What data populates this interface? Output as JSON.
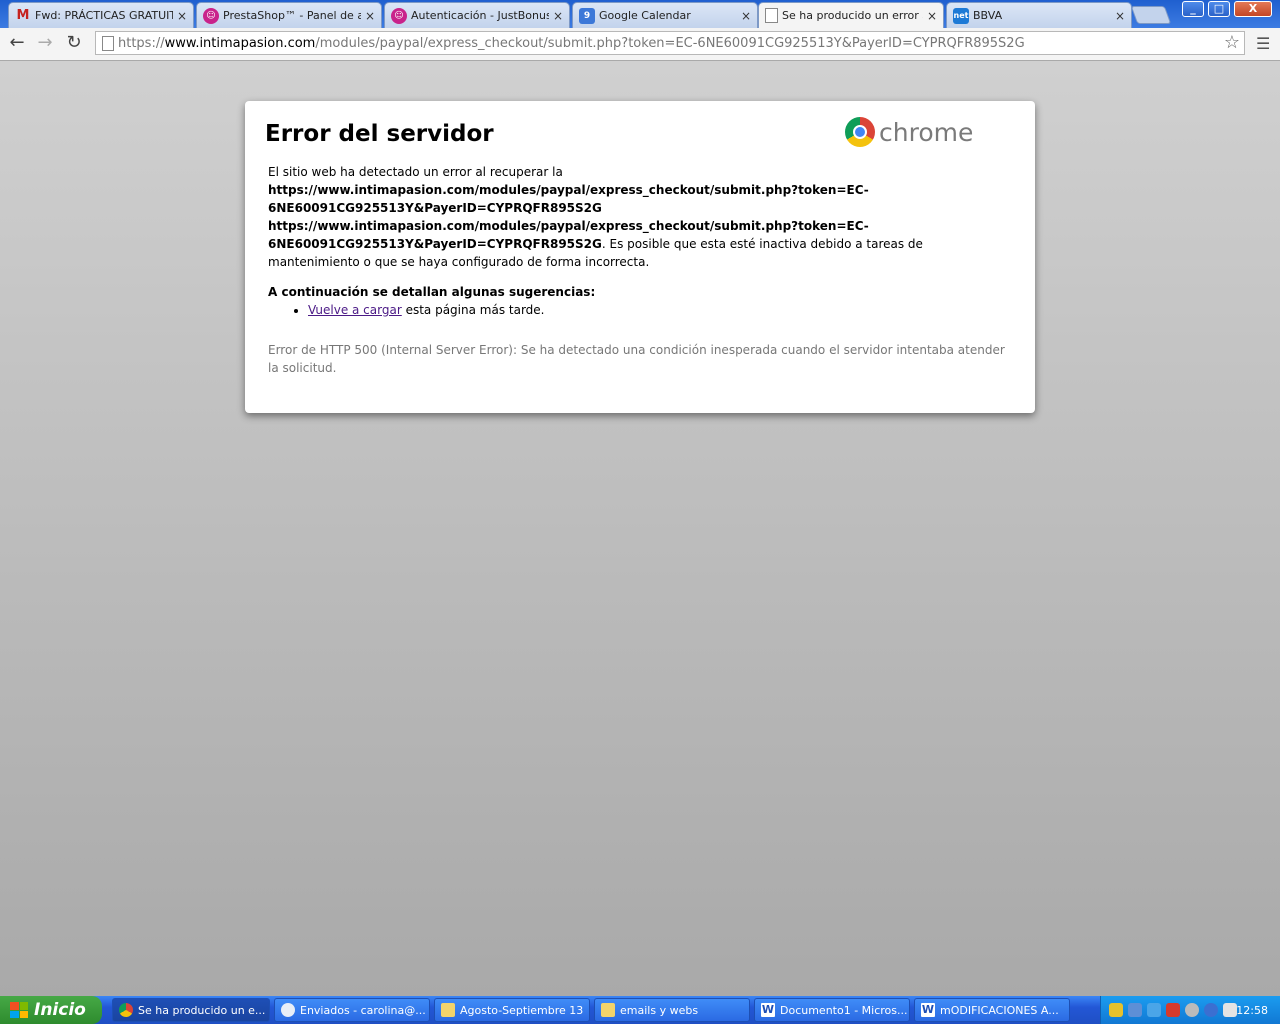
{
  "tabs": [
    {
      "title": "Fwd: PRÁCTICAS GRATUITAS",
      "icon": "gmail-icon",
      "glyph": "M"
    },
    {
      "title": "PrestaShop™ - Panel de administración",
      "icon": "prestashop-icon",
      "glyph": "☺"
    },
    {
      "title": "Autenticación - JustBonus",
      "icon": "prestashop-icon",
      "glyph": "☺"
    },
    {
      "title": "Google Calendar",
      "icon": "calendar-icon",
      "glyph": "9"
    },
    {
      "title": "Se ha producido un error al",
      "icon": "page-icon",
      "glyph": ""
    },
    {
      "title": "BBVA",
      "icon": "net-icon",
      "glyph": "net"
    }
  ],
  "tab_close_glyph": "×",
  "window_controls": {
    "minimize": "_",
    "maximize": "□",
    "close": "X"
  },
  "toolbar": {
    "back": "←",
    "forward": "→",
    "reload": "↻",
    "url_scheme": "https://",
    "url_host": "www.intimapasion.com",
    "url_path": "/modules/paypal/express_checkout/submit.php?token=EC-6NE60091CG925513Y&PayerID=CYPRQFR895S2G",
    "star": "☆",
    "menu": "☰"
  },
  "error": {
    "title": "Error del servidor",
    "logo_text": "chrome",
    "intro": "El sitio web ha detectado un error al recuperar la",
    "url_line1": "https://www.intimapasion.com/modules/paypal/express_checkout/submit.php?token=EC-",
    "url_line2": "6NE60091CG925513Y&PayerID=CYPRQFR895S2G",
    "url2_line1": "https://www.intimapasion.com/modules/paypal/express_checkout/submit.php?token=EC-",
    "url2_line2": "6NE60091CG925513Y&PayerID=CYPRQFR895S2G",
    "explanation": ". Es posible que esta esté inactiva debido a tareas de mantenimiento o que se haya configurado de forma incorrecta.",
    "suggestions_heading": "A continuación se detallan algunas sugerencias:",
    "reload_link": "Vuelve a cargar",
    "reload_rest": " esta página más tarde.",
    "detail": "Error de HTTP 500 (Internal Server Error): Se ha detectado una condición inesperada cuando el servidor intentaba atender la solicitud."
  },
  "taskbar": {
    "start_label": "Inicio",
    "tasks": [
      {
        "label": "Se ha producido un e...",
        "icon": "chrome-icon"
      },
      {
        "label": "Enviados - carolina@...",
        "icon": "mail-icon"
      },
      {
        "label": "Agosto-Septiembre 13",
        "icon": "folder-icon"
      },
      {
        "label": "emails y webs",
        "icon": "folder-icon"
      },
      {
        "label": "Documento1 - Micros...",
        "icon": "word-icon"
      },
      {
        "label": "mODIFICACIONES A...",
        "icon": "word-icon"
      }
    ],
    "clock": "12:58"
  },
  "colors": {
    "link_visited": "#4b1a86",
    "taskbar_blue": "#2357d6",
    "start_green": "#3a9a3a"
  }
}
